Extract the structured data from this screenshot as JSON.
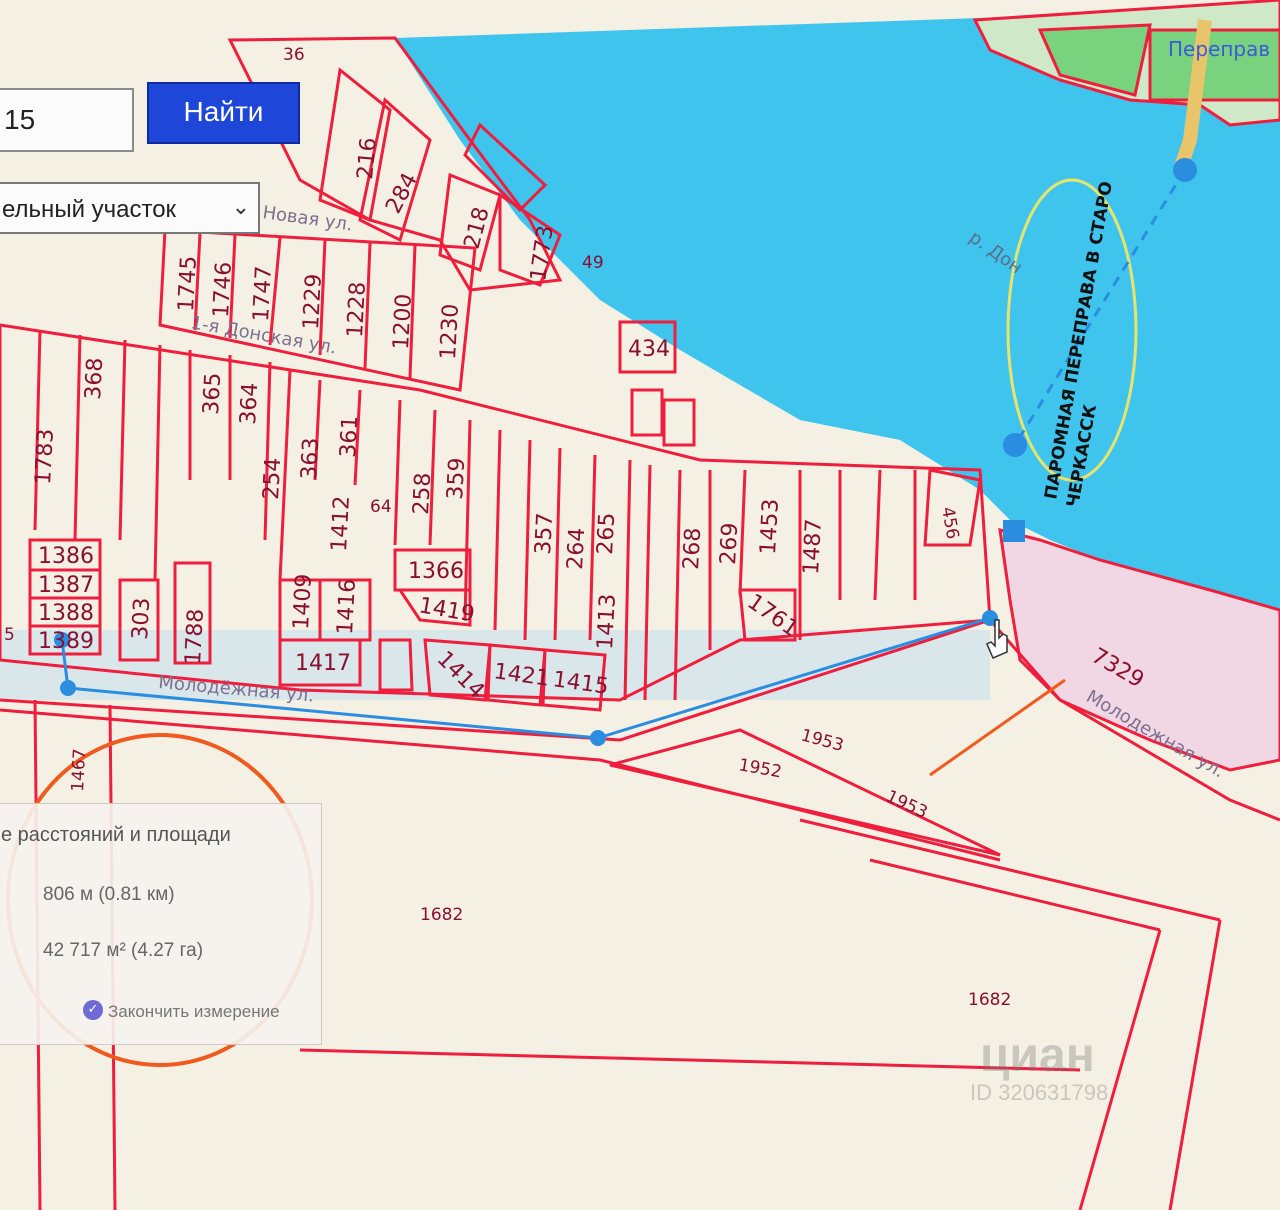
{
  "search": {
    "value": "15",
    "button_label": "Найти"
  },
  "object_type": {
    "selected": "ельный участок"
  },
  "parcels": [
    {
      "t": "36"
    },
    {
      "t": "216"
    },
    {
      "t": "284"
    },
    {
      "t": "218"
    },
    {
      "t": "1773"
    },
    {
      "t": "1745"
    },
    {
      "t": "1746"
    },
    {
      "t": "1747"
    },
    {
      "t": "1229"
    },
    {
      "t": "1228"
    },
    {
      "t": "1200"
    },
    {
      "t": "1230"
    },
    {
      "t": "434"
    },
    {
      "t": "368"
    },
    {
      "t": "365"
    },
    {
      "t": "364"
    },
    {
      "t": "1783"
    },
    {
      "t": "254"
    },
    {
      "t": "363"
    },
    {
      "t": "361"
    },
    {
      "t": "258"
    },
    {
      "t": "359"
    },
    {
      "t": "1412"
    },
    {
      "t": "357"
    },
    {
      "t": "264"
    },
    {
      "t": "265"
    },
    {
      "t": "268"
    },
    {
      "t": "269"
    },
    {
      "t": "1453"
    },
    {
      "t": "1487"
    },
    {
      "t": "456"
    },
    {
      "t": "1386"
    },
    {
      "t": "1387"
    },
    {
      "t": "1388"
    },
    {
      "t": "1389"
    },
    {
      "t": "303"
    },
    {
      "t": "1788"
    },
    {
      "t": "1409"
    },
    {
      "t": "1416"
    },
    {
      "t": "1366"
    },
    {
      "t": "1419"
    },
    {
      "t": "1413"
    },
    {
      "t": "1761"
    },
    {
      "t": "1417"
    },
    {
      "t": "1414"
    },
    {
      "t": "1421"
    },
    {
      "t": "1415"
    },
    {
      "t": "7329"
    },
    {
      "t": "1953"
    },
    {
      "t": "1952"
    },
    {
      "t": "1953"
    },
    {
      "t": "1682"
    },
    {
      "t": "1682"
    },
    {
      "t": "1467"
    },
    {
      "t": "49"
    },
    {
      "t": "64"
    },
    {
      "t": "5"
    }
  ],
  "streets": {
    "novaya": "Новая ул.",
    "donskaya": "1-я Донская ул.",
    "molodezhnaya_left": "Молодёжная ул.",
    "molodezhnaya_right": "Молодежная ул."
  },
  "river_label": "р. Дон",
  "crossing_label": "Переправ",
  "ferry_annotation": [
    "ПАРОМНАЯ ПЕРЕПРАВА В СТАРО",
    "ЧЕРКАССК"
  ],
  "measure": {
    "title": "е расстояний и площади",
    "distance": "806 м (0.81 км)",
    "area": "42 717 м² (4.27 га)",
    "finish": "Закончить измерение"
  },
  "watermark": {
    "brand": "циан",
    "id": "ID 320631798"
  },
  "colors": {
    "water": "#3fc4ee",
    "parcel_line": "#ee1e3c",
    "route": "#2a8de0",
    "annotation": "#f05a1e",
    "circle": "#e8e46a"
  }
}
